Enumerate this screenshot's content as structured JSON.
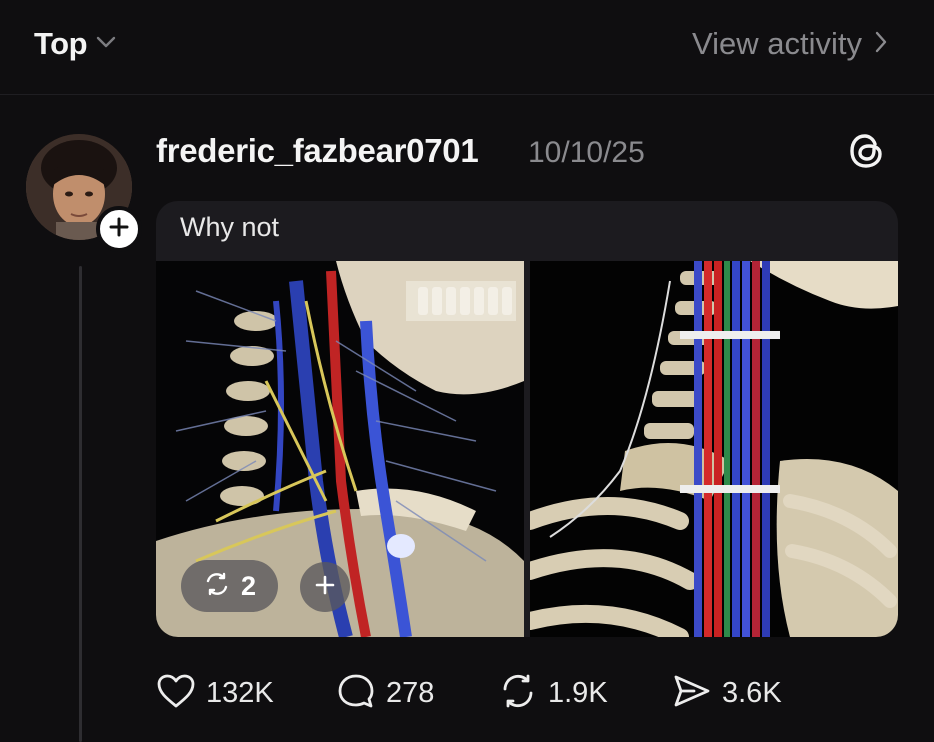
{
  "topbar": {
    "sort_label": "Top",
    "view_activity_label": "View activity"
  },
  "post": {
    "username": "frederic_fazbear0701",
    "timestamp": "10/10/25",
    "caption": "Why not",
    "carousel_count": "2",
    "actions": {
      "likes": "132K",
      "replies": "278",
      "reposts": "1.9K",
      "shares": "3.6K"
    }
  },
  "icons": {
    "sort": "chevron-down-icon",
    "view_activity": "chevron-right-icon",
    "app_logo": "threads-logo-icon",
    "follow": "plus-icon",
    "like": "heart-icon",
    "reply": "comment-icon",
    "repost": "repost-icon",
    "share": "send-icon"
  },
  "colors": {
    "background": "#0f0e10",
    "card": "#1c1b1f",
    "muted_text": "#8a8a8e"
  }
}
